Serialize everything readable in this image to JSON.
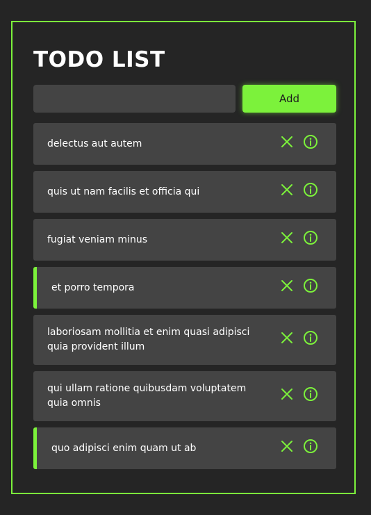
{
  "app": {
    "title": "TODO LIST"
  },
  "form": {
    "input_value": "",
    "input_placeholder": "",
    "add_label": "Add"
  },
  "colors": {
    "accent": "#7cf23b",
    "background": "#252525",
    "card": "#444444",
    "text": "#ffffff"
  },
  "icons": {
    "delete": "close-icon",
    "details": "info-icon"
  },
  "todos": [
    {
      "text": "delectus aut autem",
      "completed": false
    },
    {
      "text": "quis ut nam facilis et officia qui",
      "completed": false
    },
    {
      "text": "fugiat veniam minus",
      "completed": false
    },
    {
      "text": "et porro tempora",
      "completed": true
    },
    {
      "text": "laboriosam mollitia et enim quasi adipisci quia provident illum",
      "completed": false
    },
    {
      "text": "qui ullam ratione quibusdam voluptatem quia omnis",
      "completed": false
    },
    {
      "text": "quo adipisci enim quam ut ab",
      "completed": true
    }
  ]
}
